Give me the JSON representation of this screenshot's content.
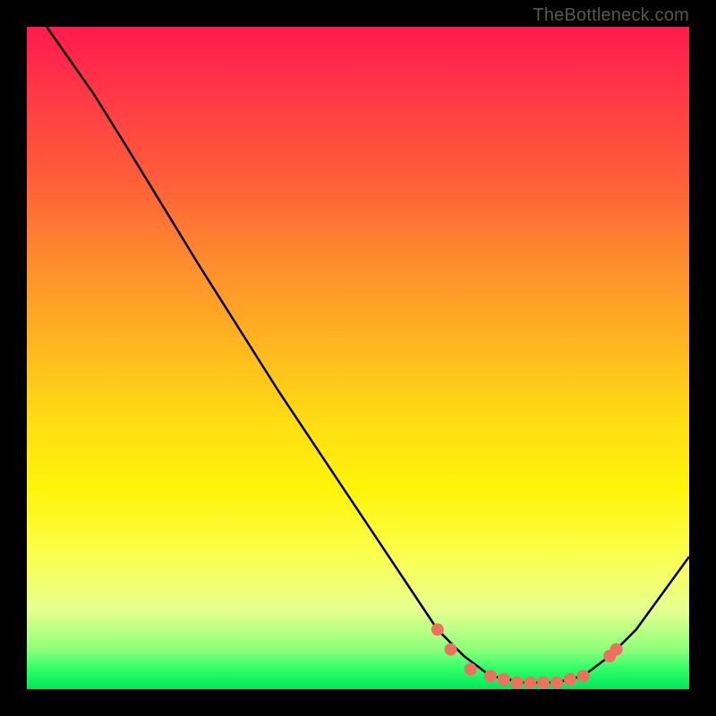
{
  "watermark": "TheBottleneck.com",
  "chart_data": {
    "type": "line",
    "title": "",
    "xlabel": "",
    "ylabel": "",
    "xlim": [
      0,
      100
    ],
    "ylim": [
      0,
      100
    ],
    "curve": [
      {
        "x": 3,
        "y": 100
      },
      {
        "x": 10,
        "y": 90
      },
      {
        "x": 15,
        "y": 82
      },
      {
        "x": 26,
        "y": 64
      },
      {
        "x": 38,
        "y": 45
      },
      {
        "x": 50,
        "y": 27
      },
      {
        "x": 58,
        "y": 15
      },
      {
        "x": 62,
        "y": 9
      },
      {
        "x": 66,
        "y": 5
      },
      {
        "x": 70,
        "y": 2
      },
      {
        "x": 75,
        "y": 1
      },
      {
        "x": 80,
        "y": 1
      },
      {
        "x": 84,
        "y": 2
      },
      {
        "x": 88,
        "y": 5
      },
      {
        "x": 92,
        "y": 9
      },
      {
        "x": 100,
        "y": 20
      }
    ],
    "markers": [
      {
        "x": 62,
        "y": 9
      },
      {
        "x": 64,
        "y": 6
      },
      {
        "x": 67,
        "y": 3
      },
      {
        "x": 70,
        "y": 2
      },
      {
        "x": 72,
        "y": 1.5
      },
      {
        "x": 74,
        "y": 1
      },
      {
        "x": 76,
        "y": 1
      },
      {
        "x": 78,
        "y": 1
      },
      {
        "x": 80,
        "y": 1
      },
      {
        "x": 82,
        "y": 1.5
      },
      {
        "x": 84,
        "y": 2
      },
      {
        "x": 88,
        "y": 5
      },
      {
        "x": 89,
        "y": 6
      }
    ],
    "marker_color": "#f07060",
    "line_color": "#000000"
  }
}
